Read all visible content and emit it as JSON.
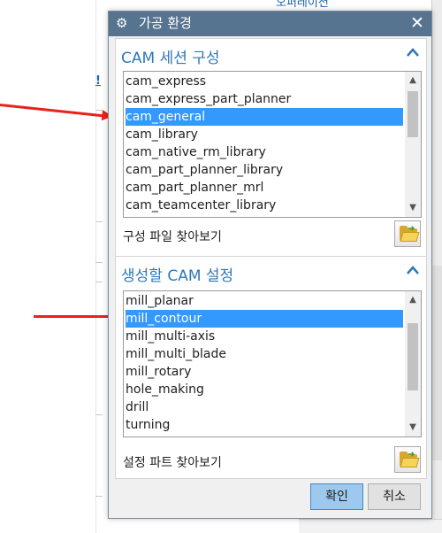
{
  "background": {
    "heading": "오퍼레이션",
    "marker": "!"
  },
  "dialog": {
    "title": "가공 환경",
    "icon": "gear-icon",
    "close_glyph": "✕"
  },
  "session_config": {
    "title": "CAM 세션 구성",
    "items": [
      "cam_express",
      "cam_express_part_planner",
      "cam_general",
      "cam_library",
      "cam_native_rm_library",
      "cam_part_planner_library",
      "cam_part_planner_mrl",
      "cam_teamcenter_library"
    ],
    "selected": "cam_general",
    "browse_label": "구성 파일 찾아보기"
  },
  "setup_to_create": {
    "title": "생성할 CAM 설정",
    "items": [
      "mill_planar",
      "mill_contour",
      "mill_multi-axis",
      "mill_multi_blade",
      "mill_rotary",
      "hole_making",
      "drill",
      "turning"
    ],
    "selected": "mill_contour",
    "browse_label": "설정 파트 찾아보기"
  },
  "buttons": {
    "ok": "확인",
    "cancel": "취소"
  },
  "colors": {
    "titlebar": "#56748f",
    "section_title": "#2f77b8",
    "selection": "#3399ff",
    "arrow": "#e8211b",
    "ok_button": "#9ec9ee"
  }
}
